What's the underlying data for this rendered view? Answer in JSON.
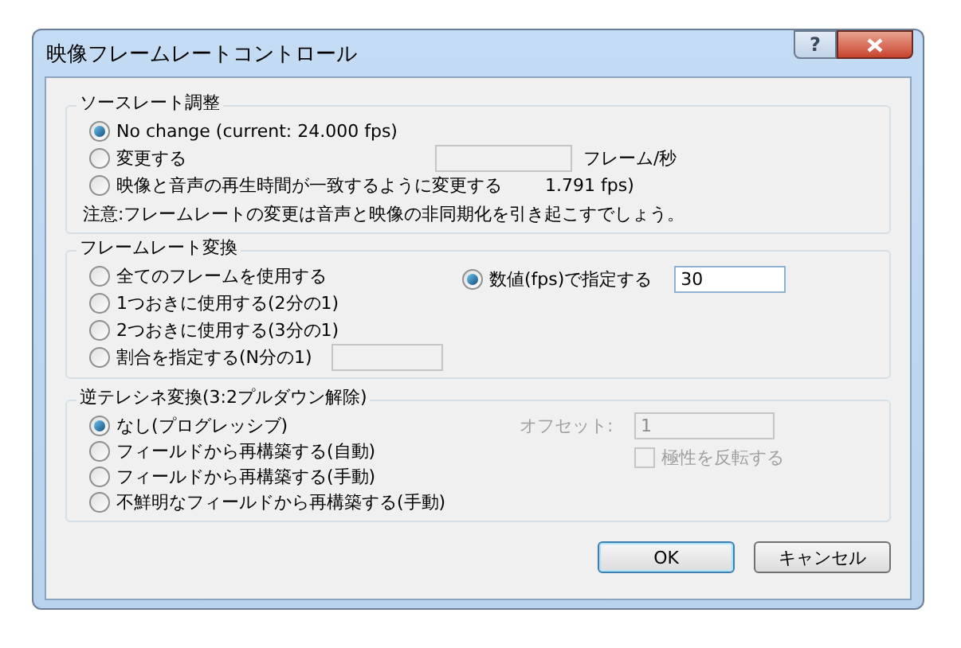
{
  "window": {
    "title": "映像フレームレートコントロール",
    "help_label": "?"
  },
  "source_rate": {
    "title": "ソースレート調整",
    "options": [
      {
        "label": "No change (current: 24.000 fps)",
        "selected": true
      },
      {
        "label": "変更する",
        "selected": false
      },
      {
        "label": "映像と音声の再生時間が一致するように変更する",
        "selected": false
      }
    ],
    "rate_field": {
      "disabled": true
    },
    "unit": "フレーム/秒",
    "computed_rate": "1.791 fps)",
    "note": "注意:フレームレートの変更は音声と映像の非同期化を引き起こすでしょう。"
  },
  "conversion": {
    "title": "フレームレート変換",
    "options": [
      {
        "label": "全てのフレームを使用する",
        "selected": false
      },
      {
        "label": "1つおきに使用する(2分の1)",
        "selected": false
      },
      {
        "label": "2つおきに使用する(3分の1)",
        "selected": false
      },
      {
        "label": "割合を指定する(N分の1)",
        "selected": false,
        "field": {
          "disabled": true
        }
      }
    ],
    "fps_option": {
      "label": "数値(fps)で指定する",
      "selected": true,
      "field": {
        "value": "30",
        "disabled": false
      }
    }
  },
  "ivtc": {
    "title": "逆テレシネ変換(3:2プルダウン解除)",
    "options": [
      {
        "label": "なし(プログレッシブ)",
        "selected": true
      },
      {
        "label": "フィールドから再構築する(自動)",
        "selected": false
      },
      {
        "label": "フィールドから再構築する(手動)",
        "selected": false
      },
      {
        "label": "不鮮明なフィールドから再構築する(手動)",
        "selected": false
      }
    ],
    "offset": {
      "label": "オフセット:",
      "value": "1",
      "disabled": true
    },
    "invert": {
      "label": "極性を反転する",
      "checked": false,
      "disabled": true
    }
  },
  "buttons": [
    {
      "label": "OK",
      "default": true
    },
    {
      "label": "キャンセル",
      "default": false
    }
  ]
}
